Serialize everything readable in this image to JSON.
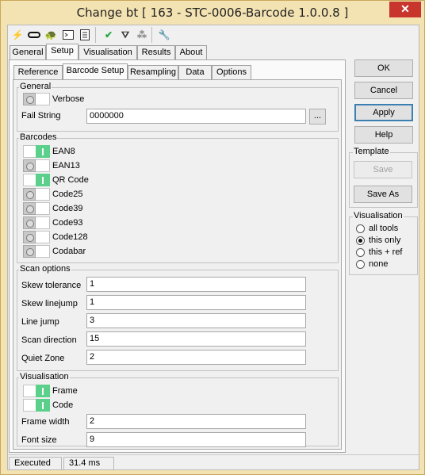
{
  "window": {
    "title": "Change bt [ 163 - STC-0006-Barcode 1.0.0.8 ]",
    "close_glyph": "✕"
  },
  "toolbar": {
    "icons": [
      "lightning-icon",
      "link-icon",
      "turtle-icon",
      "console-icon",
      "notes-icon",
      "check-icon",
      "graph-icon",
      "grid-icon",
      "wrench-icon"
    ]
  },
  "main_tabs": [
    "General",
    "Setup",
    "Visualisation",
    "Results",
    "About"
  ],
  "active_main_tab": "Setup",
  "sub_tabs": [
    "Reference",
    "Barcode Setup",
    "Resampling",
    "Data",
    "Options"
  ],
  "active_sub_tab": "Barcode Setup",
  "general": {
    "label": "General",
    "verbose": {
      "label": "Verbose",
      "on": false
    },
    "fail_string": {
      "label": "Fail String",
      "value": "0000000",
      "browse": "..."
    }
  },
  "barcodes": {
    "label": "Barcodes",
    "items": [
      {
        "label": "EAN8",
        "on": true
      },
      {
        "label": "EAN13",
        "on": false
      },
      {
        "label": "QR Code",
        "on": true
      },
      {
        "label": "Code25",
        "on": false
      },
      {
        "label": "Code39",
        "on": false
      },
      {
        "label": "Code93",
        "on": false
      },
      {
        "label": "Code128",
        "on": false
      },
      {
        "label": "Codabar",
        "on": false
      }
    ]
  },
  "scan_options": {
    "label": "Scan options",
    "fields": [
      {
        "label": "Skew tolerance",
        "value": "1"
      },
      {
        "label": "Skew linejump",
        "value": "1"
      },
      {
        "label": "Line jump",
        "value": "3"
      },
      {
        "label": "Scan direction",
        "value": "15"
      },
      {
        "label": "Quiet Zone",
        "value": "2"
      }
    ]
  },
  "visualisation_group": {
    "label": "Visualisation",
    "frame": {
      "label": "Frame",
      "on": true
    },
    "code": {
      "label": "Code",
      "on": true
    },
    "frame_width": {
      "label": "Frame width",
      "value": "2"
    },
    "font_size": {
      "label": "Font size",
      "value": "9"
    }
  },
  "buttons": {
    "ok": "OK",
    "cancel": "Cancel",
    "apply": "Apply",
    "help": "Help"
  },
  "template": {
    "label": "Template",
    "save": "Save",
    "save_as": "Save As"
  },
  "visualisation_radio": {
    "label": "Visualisation",
    "options": [
      "all tools",
      "this only",
      "this + ref",
      "none"
    ],
    "selected": "this only"
  },
  "status": {
    "state": "Executed",
    "time": "31.4 ms"
  },
  "colors": {
    "toggle_on": "#5bd08a",
    "title_bar": "#f4e3b2",
    "close": "#c7352c"
  }
}
